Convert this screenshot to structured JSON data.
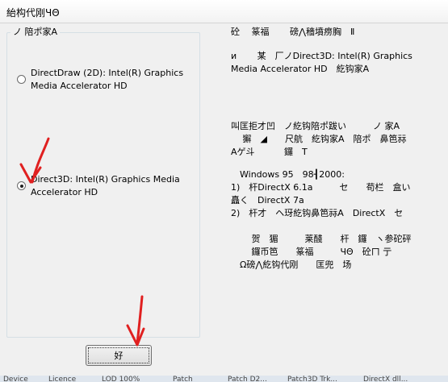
{
  "window": {
    "title": "紿构代刚ЧΘ"
  },
  "group": {
    "legend": "ノ 陪ポ家A",
    "options": [
      {
        "label": "DirectDraw (2D): Intel(R) Graphics Media Accelerator HD",
        "selected": false
      },
      {
        "label": "Direct3D: Intel(R) Graphics Media Accelerator HD",
        "selected": true
      }
    ]
  },
  "info": {
    "lines": [
      "砼　 篆福　　 磅⋀穡墳痨胸　Ⅱ",
      "",
      "и　　 某　厂ノDirect3D: Intel(R) Graphics",
      "Media Accelerator HD　紇钩家A",
      "",
      "",
      "",
      "",
      "叫匡拒才凹　ノ紇钩陪ポ跋い　　　ノ 家A",
      "　 獬　◢　　尺航　紇钩家A　陪ポ　鼻笆祘",
      "Aゲ斗　　　 鑼　T",
      "",
      "　Windows 95　98┨2000:",
      "1)　杆DirectX 6.1a　　　セ　　苟栏　盒い",
      "矗く　DirectX 7a",
      "2)　杆才　ヘ玡紇钩鼻笆祘A　DirectX　セ",
      "",
      "　　 贺　猸　　　莱醆　　杆　鑼　ヽ参砣砰",
      "　　 鑼币笆　　篆福　　　ЧΘ　砼ㄇ 亍",
      "　Ω磅⋀紇钩代刚　　匡兜　场"
    ]
  },
  "buttons": {
    "ok": "好"
  },
  "behind_window": {
    "items": [
      "Device",
      "Licence",
      "LOD 100%",
      "Patch",
      "Patch D2...",
      "Patch3D Trk...",
      "DirectX dll..."
    ]
  },
  "annotations": {
    "color": "#e02020",
    "shapes": [
      "arrow-to-direct3d-option",
      "arrow-to-ok-button"
    ]
  }
}
